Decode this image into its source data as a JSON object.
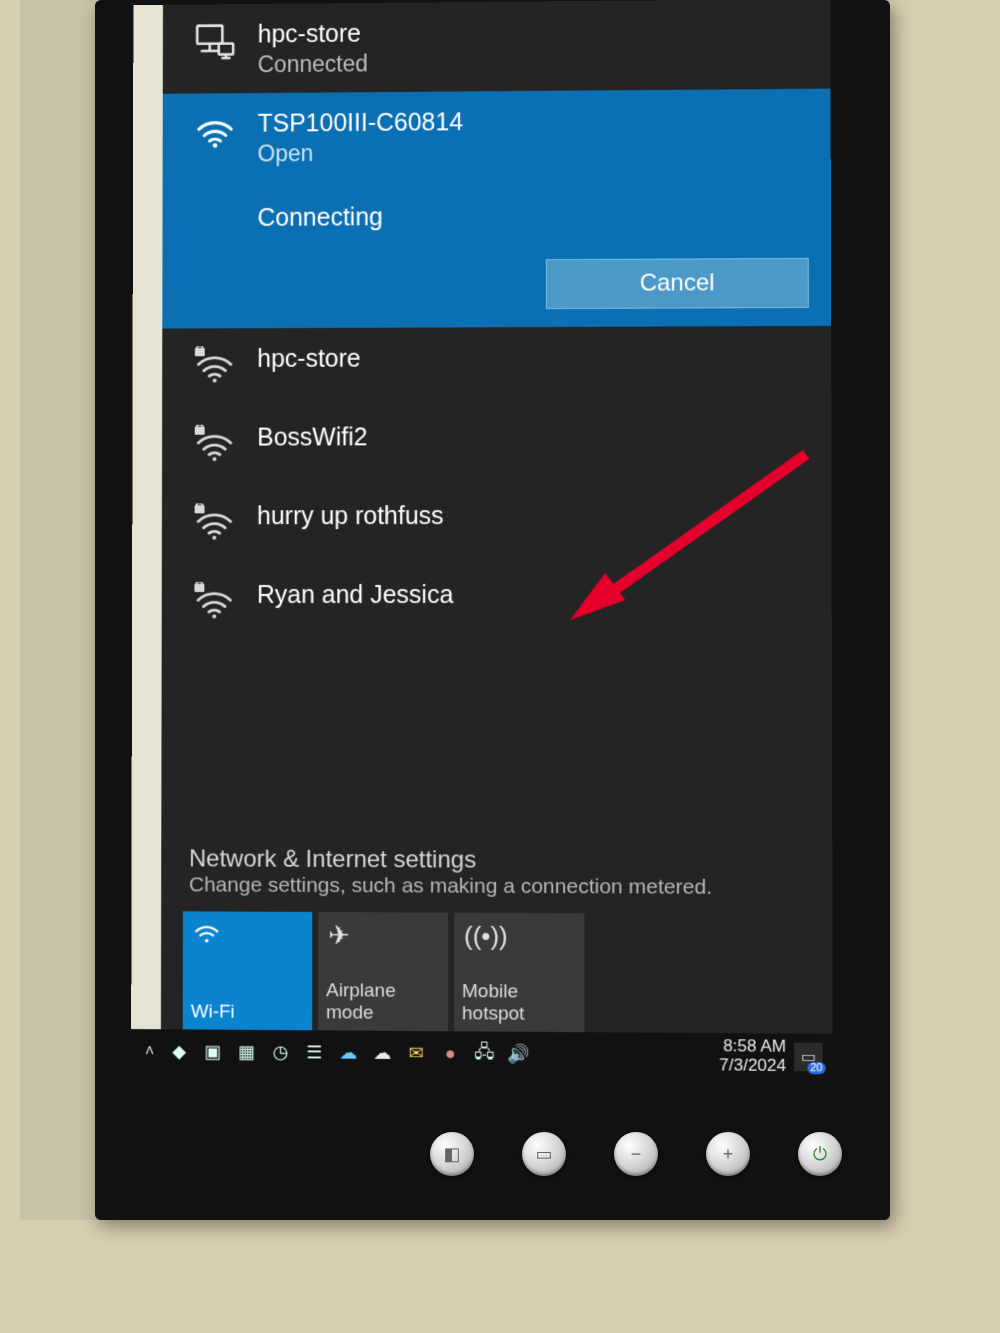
{
  "ethernet": {
    "name": "hpc-store",
    "status": "Connected"
  },
  "selected_wifi": {
    "name": "TSP100III-C60814",
    "security": "Open",
    "state": "Connecting",
    "cancel_label": "Cancel"
  },
  "other_wifi": [
    {
      "name": "hpc-store",
      "secured": true
    },
    {
      "name": "BossWifi2",
      "secured": true
    },
    {
      "name": "hurry up rothfuss",
      "secured": true
    },
    {
      "name": "Ryan and Jessica",
      "secured": true
    }
  ],
  "settings": {
    "title": "Network & Internet settings",
    "subtitle": "Change settings, such as making a connection metered."
  },
  "tiles": {
    "wifi": "Wi-Fi",
    "airplane": "Airplane mode",
    "hotspot": "Mobile hotspot"
  },
  "clock": {
    "time": "8:58 AM",
    "date": "7/3/2024"
  },
  "notification_count": "20",
  "annotation": {
    "arrow_target_index": 2
  }
}
